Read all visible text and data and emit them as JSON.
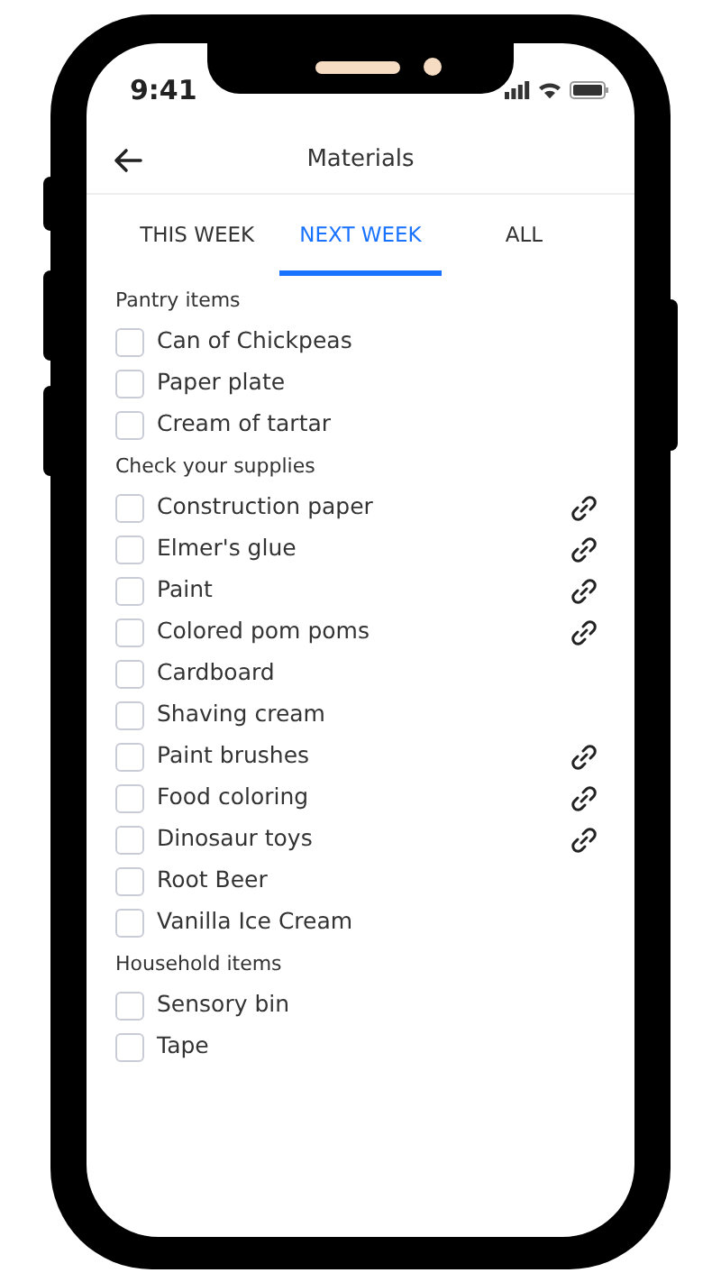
{
  "status_bar": {
    "time": "9:41"
  },
  "header": {
    "title": "Materials"
  },
  "tabs": [
    {
      "label": "THIS WEEK",
      "selected": false
    },
    {
      "label": "NEXT WEEK",
      "selected": true
    },
    {
      "label": "ALL",
      "selected": false
    }
  ],
  "sections": [
    {
      "title": "Pantry items",
      "items": [
        {
          "label": "Can of Chickpeas",
          "checked": false,
          "linked": false
        },
        {
          "label": "Paper plate",
          "checked": false,
          "linked": false
        },
        {
          "label": "Cream of tartar",
          "checked": false,
          "linked": false
        }
      ]
    },
    {
      "title": "Check your supplies",
      "items": [
        {
          "label": "Construction paper",
          "checked": false,
          "linked": true
        },
        {
          "label": "Elmer's glue",
          "checked": false,
          "linked": true
        },
        {
          "label": "Paint",
          "checked": false,
          "linked": true
        },
        {
          "label": "Colored pom poms",
          "checked": false,
          "linked": true
        },
        {
          "label": "Cardboard",
          "checked": false,
          "linked": false
        },
        {
          "label": "Shaving cream",
          "checked": false,
          "linked": false
        },
        {
          "label": "Paint brushes",
          "checked": false,
          "linked": true
        },
        {
          "label": "Food coloring",
          "checked": false,
          "linked": true
        },
        {
          "label": "Dinosaur toys",
          "checked": false,
          "linked": true
        },
        {
          "label": "Root Beer",
          "checked": false,
          "linked": false
        },
        {
          "label": "Vanilla Ice Cream",
          "checked": false,
          "linked": false
        }
      ]
    },
    {
      "title": "Household items",
      "items": [
        {
          "label": "Sensory bin",
          "checked": false,
          "linked": false
        },
        {
          "label": "Tape",
          "checked": false,
          "linked": false
        }
      ]
    }
  ]
}
